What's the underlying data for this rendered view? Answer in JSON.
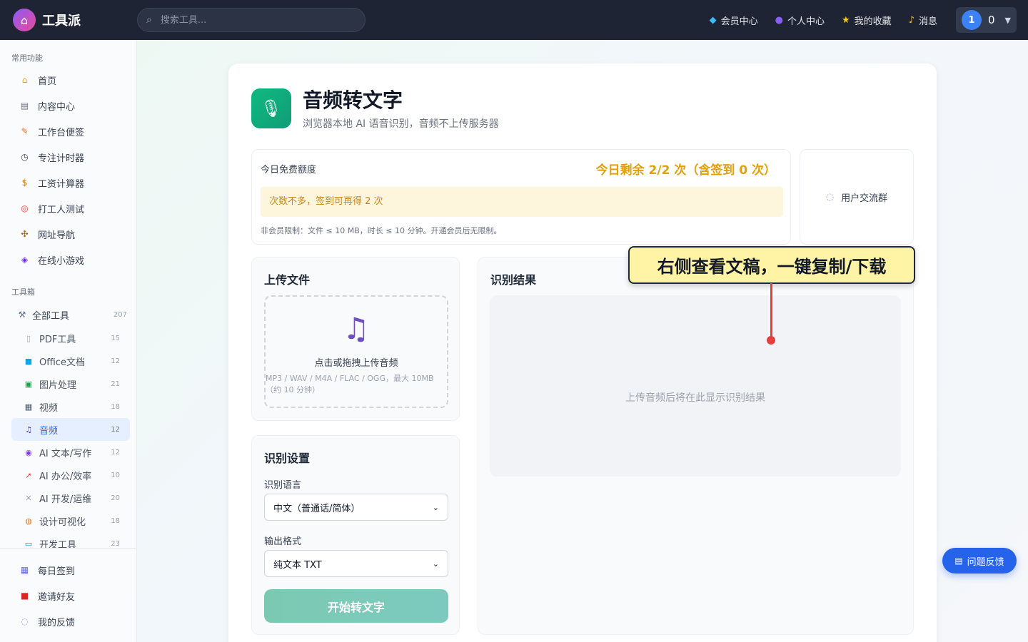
{
  "topbar": {
    "brand": "工具派",
    "search_placeholder": "搜索工具...",
    "links": [
      {
        "label": "会员中心",
        "icon": "diamond-icon"
      },
      {
        "label": "个人中心",
        "icon": "person-icon"
      },
      {
        "label": "我的收藏",
        "icon": "star-icon"
      },
      {
        "label": "消息",
        "icon": "bell-icon"
      }
    ],
    "user": {
      "avatar": "1",
      "count": "0"
    }
  },
  "sidebar": {
    "common_title": "常用功能",
    "common_items": [
      {
        "label": "首页",
        "icon": "house-icon"
      },
      {
        "label": "内容中心",
        "icon": "newspaper-icon"
      },
      {
        "label": "工作台便签",
        "icon": "memo-icon"
      },
      {
        "label": "专注计时器",
        "icon": "stopwatch-icon"
      },
      {
        "label": "工资计算器",
        "icon": "money-bag-icon"
      },
      {
        "label": "打工人测试",
        "icon": "target-icon"
      },
      {
        "label": "网址导航",
        "icon": "compass-icon"
      },
      {
        "label": "在线小游戏",
        "icon": "gamepad-icon"
      }
    ],
    "toolbox_title": "工具箱",
    "all_tools": {
      "label": "全部工具",
      "count": "207",
      "icon": "tools-icon"
    },
    "categories": [
      {
        "label": "PDF工具",
        "count": "15",
        "icon": "document-icon"
      },
      {
        "label": "Office文档",
        "count": "12",
        "icon": "book-icon"
      },
      {
        "label": "图片处理",
        "count": "21",
        "icon": "picture-icon"
      },
      {
        "label": "视频",
        "count": "18",
        "icon": "clapper-icon"
      },
      {
        "label": "音频",
        "count": "12",
        "icon": "music-note-icon",
        "active": true
      },
      {
        "label": "AI 文本/写作",
        "count": "12",
        "icon": "robot-icon"
      },
      {
        "label": "AI 办公/效率",
        "count": "10",
        "icon": "rocket-icon"
      },
      {
        "label": "AI 开发/运维",
        "count": "20",
        "icon": "wrench-icon"
      },
      {
        "label": "设计可视化",
        "count": "18",
        "icon": "palette-icon"
      },
      {
        "label": "开发工具",
        "count": "23",
        "icon": "computer-icon"
      }
    ],
    "bottom_items": [
      {
        "label": "每日签到",
        "icon": "calendar-icon"
      },
      {
        "label": "邀请好友",
        "icon": "gift-icon"
      },
      {
        "label": "我的反馈",
        "icon": "speech-bubble-icon"
      }
    ]
  },
  "page": {
    "title": "音频转文字",
    "subtitle": "浏览器本地 AI 语音识别，音频不上传服务器",
    "quota": {
      "label": "今日免费额度",
      "remaining": "今日剩余 2/2 次（含签到 0 次）",
      "tip": "次数不多，签到可再得 2 次",
      "note": "非会员限制：文件 ≤ 10 MB，时长 ≤ 10 分钟。开通会员后无限制。"
    },
    "group_link": "用户交流群",
    "upload": {
      "title": "上传文件",
      "main_text": "点击或拖拽上传音频",
      "sub_text": "MP3 / WAV / M4A / FLAC / OGG，最大 10MB（约 10 分钟）"
    },
    "settings": {
      "title": "识别设置",
      "language_label": "识别语言",
      "language_value": "中文（普通话/简体）",
      "format_label": "输出格式",
      "format_value": "纯文本 TXT",
      "start_button": "开始转文字"
    },
    "result": {
      "title": "识别结果",
      "placeholder": "上传音频后将在此显示识别结果"
    },
    "callout": "右侧查看文稿，一键复制/下载",
    "feedback": "问题反馈"
  },
  "colors": {
    "topbar": "#1e2433",
    "accent": "#2563eb",
    "quota_highlight": "#e3a008",
    "hero_icon": "#10b981",
    "start_button": "#7cc9b2"
  }
}
